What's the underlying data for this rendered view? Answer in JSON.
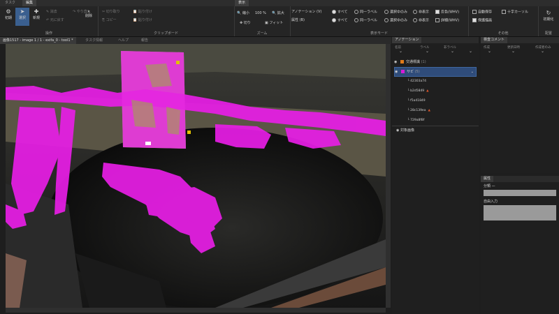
{
  "tabs": [
    {
      "label": "タスク",
      "active": false
    },
    {
      "label": "編集",
      "active": true
    },
    {
      "label": "表示",
      "active": true
    }
  ],
  "ribbon": {
    "operation": {
      "label": "操作",
      "buttons": [
        {
          "label": "初期",
          "icon": "gear-icon",
          "selected": false
        },
        {
          "label": "選択",
          "icon": "cursor-icon",
          "selected": true
        },
        {
          "label": "新規",
          "icon": "plus-icon",
          "selected": false
        }
      ],
      "small": [
        "消去",
        "削除",
        "元に戻す",
        "やり直し"
      ]
    },
    "clipboard": {
      "label": "クリップボード",
      "items": [
        "切り取り",
        "コピー",
        "貼り付け",
        "貼り付け"
      ]
    },
    "zoom": {
      "label": "ズーム",
      "zoom_out": "縮小",
      "zoom_value": "100 %",
      "zoom_in": "拡大",
      "crop": "切り",
      "fit": "フィット"
    },
    "display_mode": {
      "label": "表示モード",
      "annotation_label": "アノテーション (V)",
      "attribute_label": "属性 (B)",
      "opt_all": "すべて",
      "opt_same_label": "同一ラベル",
      "opt_selected": "選択中のみ",
      "opt_hidden": "非表示",
      "opt_color": "反色(WHV)",
      "opt_detail": "詳細(WHV)"
    },
    "other": {
      "label": "その他",
      "items": [
        "自動保存",
        "十字カーソル",
        "保護描画"
      ]
    },
    "arrange": {
      "label": "配置",
      "button": "初期化"
    }
  },
  "document_tabs": [
    {
      "label": "画像1517 - image 1 / 1 - exifa_0 - tool1 *",
      "active": true
    },
    {
      "label": "タスク情報",
      "active": false
    },
    {
      "label": "ヘルプ",
      "active": false
    },
    {
      "label": "報告",
      "active": false
    }
  ],
  "annotation_panel": {
    "tab": "アノテーション",
    "columns": [
      "名前",
      "ラベル",
      "非ラベル"
    ],
    "layers": [
      {
        "label": "交通標識",
        "suffix": "(1)",
        "color": "#e07b1a",
        "selected": false
      },
      {
        "label": "サビ",
        "suffix": "(5)",
        "color": "#d81bd8",
        "selected": true
      }
    ],
    "sub_items": [
      {
        "id": "42303a74",
        "warning": false
      },
      {
        "id": "b2d5849",
        "warning": true
      },
      {
        "id": "f5a41849",
        "warning": false
      },
      {
        "id": "28c139ea",
        "warning": true
      },
      {
        "id": "729a8f8f",
        "warning": false
      }
    ],
    "footer": "対象画像"
  },
  "comment_panel": {
    "tab": "検査コメント",
    "columns": [
      "作成",
      "更新日時",
      "作成者のみ"
    ]
  },
  "attribute_panel": {
    "tab": "属性",
    "type_label": "分類 —",
    "input_label": "自由入力"
  },
  "colors": {
    "overlay": "#e81ee6",
    "accent": "#3a5f8f",
    "warning": "#e0562a"
  }
}
